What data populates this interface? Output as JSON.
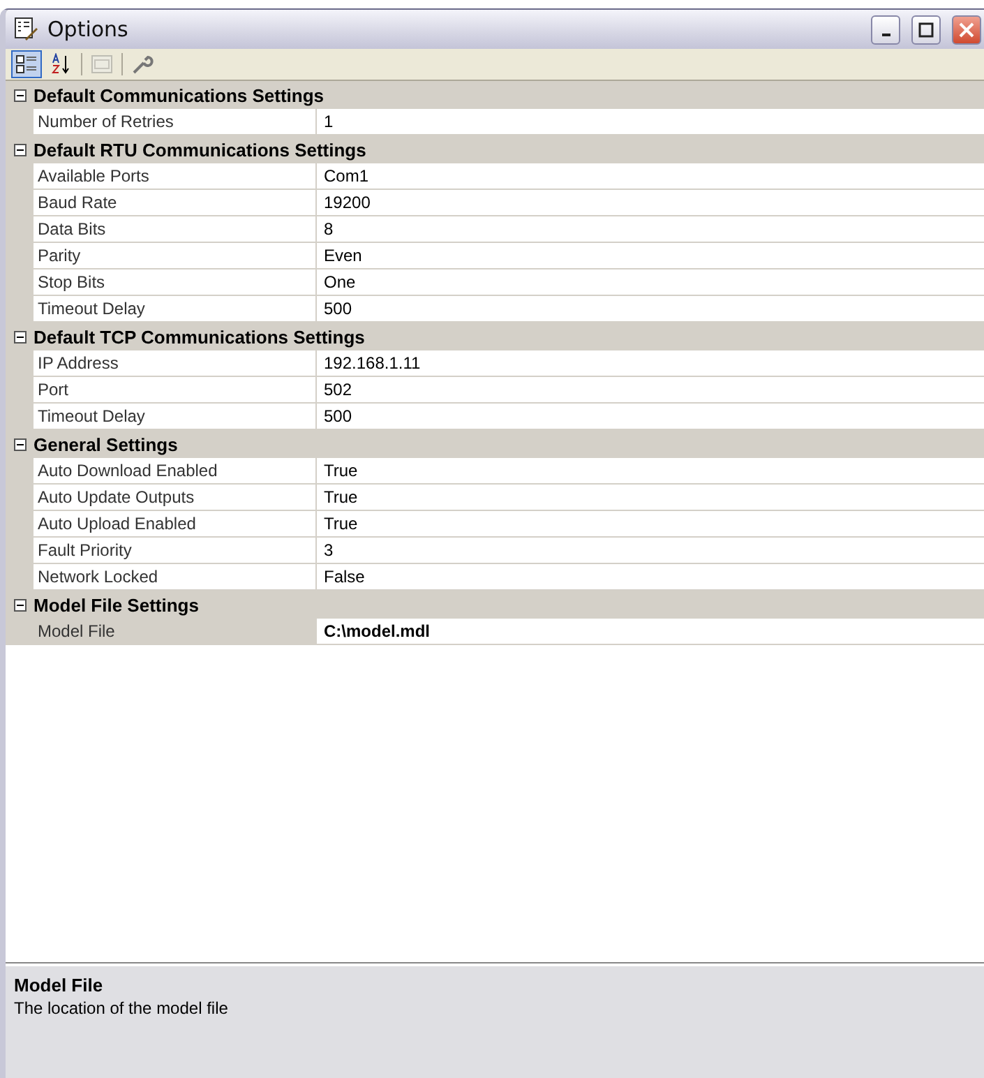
{
  "window": {
    "title": "Options"
  },
  "toolbar": [
    {
      "kind": "categorized",
      "selected": true,
      "disabled": false
    },
    {
      "kind": "alphabetical",
      "selected": false,
      "disabled": false
    },
    {
      "kind": "pages",
      "selected": false,
      "disabled": true
    },
    {
      "kind": "wrench",
      "selected": false,
      "disabled": false
    }
  ],
  "categories": [
    {
      "name": "Default Communications Settings",
      "expanded": true,
      "properties": [
        {
          "name": "Number of Retries",
          "value": "1",
          "selected": false,
          "modified": false
        }
      ]
    },
    {
      "name": "Default RTU Communications Settings",
      "expanded": true,
      "properties": [
        {
          "name": "Available Ports",
          "value": "Com1",
          "selected": false,
          "modified": false
        },
        {
          "name": "Baud Rate",
          "value": "19200",
          "selected": false,
          "modified": false
        },
        {
          "name": "Data Bits",
          "value": "8",
          "selected": false,
          "modified": false
        },
        {
          "name": "Parity",
          "value": "Even",
          "selected": false,
          "modified": false
        },
        {
          "name": "Stop Bits",
          "value": "One",
          "selected": false,
          "modified": false
        },
        {
          "name": "Timeout Delay",
          "value": "500",
          "selected": false,
          "modified": false
        }
      ]
    },
    {
      "name": "Default TCP Communications Settings",
      "expanded": true,
      "properties": [
        {
          "name": "IP Address",
          "value": "192.168.1.11",
          "selected": false,
          "modified": false
        },
        {
          "name": "Port",
          "value": "502",
          "selected": false,
          "modified": false
        },
        {
          "name": "Timeout Delay",
          "value": "500",
          "selected": false,
          "modified": false
        }
      ]
    },
    {
      "name": "General Settings",
      "expanded": true,
      "properties": [
        {
          "name": "Auto Download Enabled",
          "value": "True",
          "selected": false,
          "modified": false
        },
        {
          "name": "Auto Update Outputs",
          "value": "True",
          "selected": false,
          "modified": false
        },
        {
          "name": "Auto Upload Enabled",
          "value": "True",
          "selected": false,
          "modified": false
        },
        {
          "name": "Fault Priority",
          "value": "3",
          "selected": false,
          "modified": false
        },
        {
          "name": "Network Locked",
          "value": "False",
          "selected": false,
          "modified": false
        }
      ]
    },
    {
      "name": "Model File Settings",
      "expanded": true,
      "properties": [
        {
          "name": "Model File",
          "value": "C:\\model.mdl",
          "selected": true,
          "modified": true
        }
      ]
    }
  ],
  "description": {
    "title": "Model File",
    "text": "The location of the model file"
  }
}
